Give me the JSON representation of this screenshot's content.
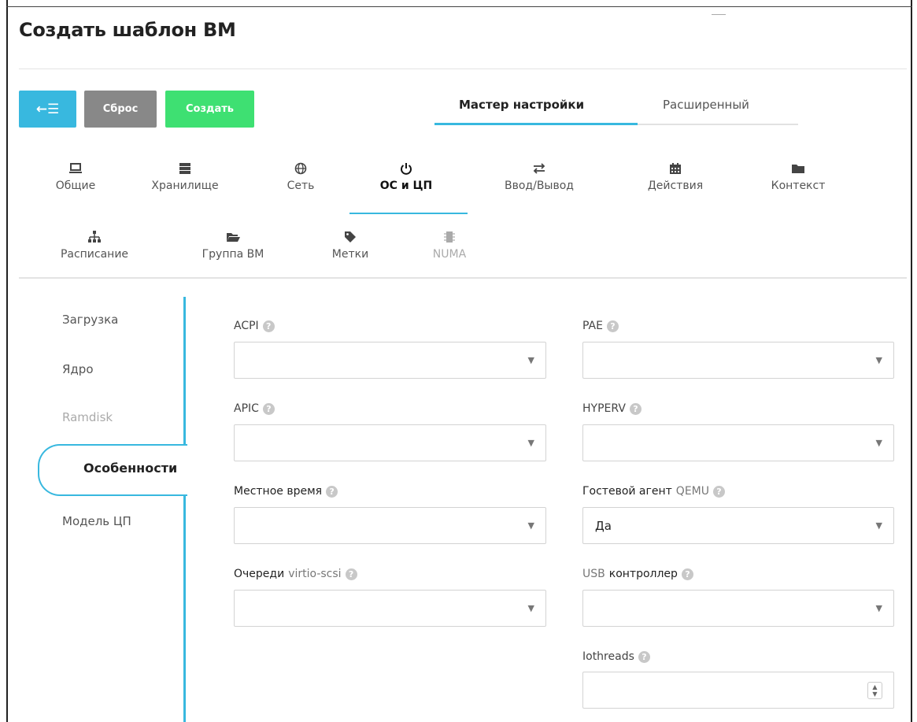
{
  "page_title": "Создать шаблон ВМ",
  "toolbar": {
    "back_label": "←☰",
    "reset_label": "Сброс",
    "create_label": "Создать"
  },
  "mode_tabs": {
    "wizard": "Мастер настройки",
    "advanced": "Расширенный",
    "active": "wizard"
  },
  "section_tabs": [
    {
      "label": "Общие",
      "icon": "laptop-icon",
      "glyph": "💻"
    },
    {
      "label": "Хранилище",
      "icon": "storage-icon",
      "glyph": "☰"
    },
    {
      "label": "Сеть",
      "icon": "globe-icon",
      "glyph": "🌐"
    },
    {
      "label": "ОС и ЦП",
      "icon": "power-icon",
      "glyph": "⏻"
    },
    {
      "label": "Ввод/Вывод",
      "icon": "exchange-icon",
      "glyph": "⇄"
    },
    {
      "label": "Действия",
      "icon": "calendar-icon",
      "glyph": "▦"
    },
    {
      "label": "Контекст",
      "icon": "folder-icon",
      "glyph": "▬"
    },
    {
      "label": "Расписание",
      "icon": "sitemap-icon",
      "glyph": "⊥"
    },
    {
      "label": "Группа ВМ",
      "icon": "folder-open-icon",
      "glyph": "▰"
    },
    {
      "label": "Метки",
      "icon": "tag-icon",
      "glyph": "◆"
    },
    {
      "label": "NUMA",
      "icon": "chip-icon",
      "glyph": "▮"
    }
  ],
  "active_section": "ОС и ЦП",
  "side_nav": {
    "items": [
      "Загрузка",
      "Ядро",
      "Ramdisk",
      "Особенности",
      "Модель ЦП"
    ],
    "active": "Особенности",
    "disabled": [
      "Ramdisk"
    ]
  },
  "fields": {
    "acpi": {
      "label": "ACPI",
      "value": ""
    },
    "pae": {
      "label": "PAE",
      "value": ""
    },
    "apic": {
      "label": "APIC",
      "value": ""
    },
    "hyperv": {
      "label": "HYPERV",
      "value": ""
    },
    "localtime": {
      "label": "Местное время",
      "value": ""
    },
    "guest_agent": {
      "label_a": "Гостевой агент",
      "label_b": "QEMU",
      "value": "Да"
    },
    "virtio_queues": {
      "label_a": "Очереди",
      "label_b": "virtio-scsi",
      "value": ""
    },
    "usb": {
      "label_a": "USB",
      "label_b": "контроллер",
      "value": ""
    },
    "iothreads": {
      "label": "Iothreads",
      "value": ""
    }
  },
  "colors": {
    "accent": "#38b8df",
    "reset": "#888888",
    "create": "#3ee072"
  }
}
